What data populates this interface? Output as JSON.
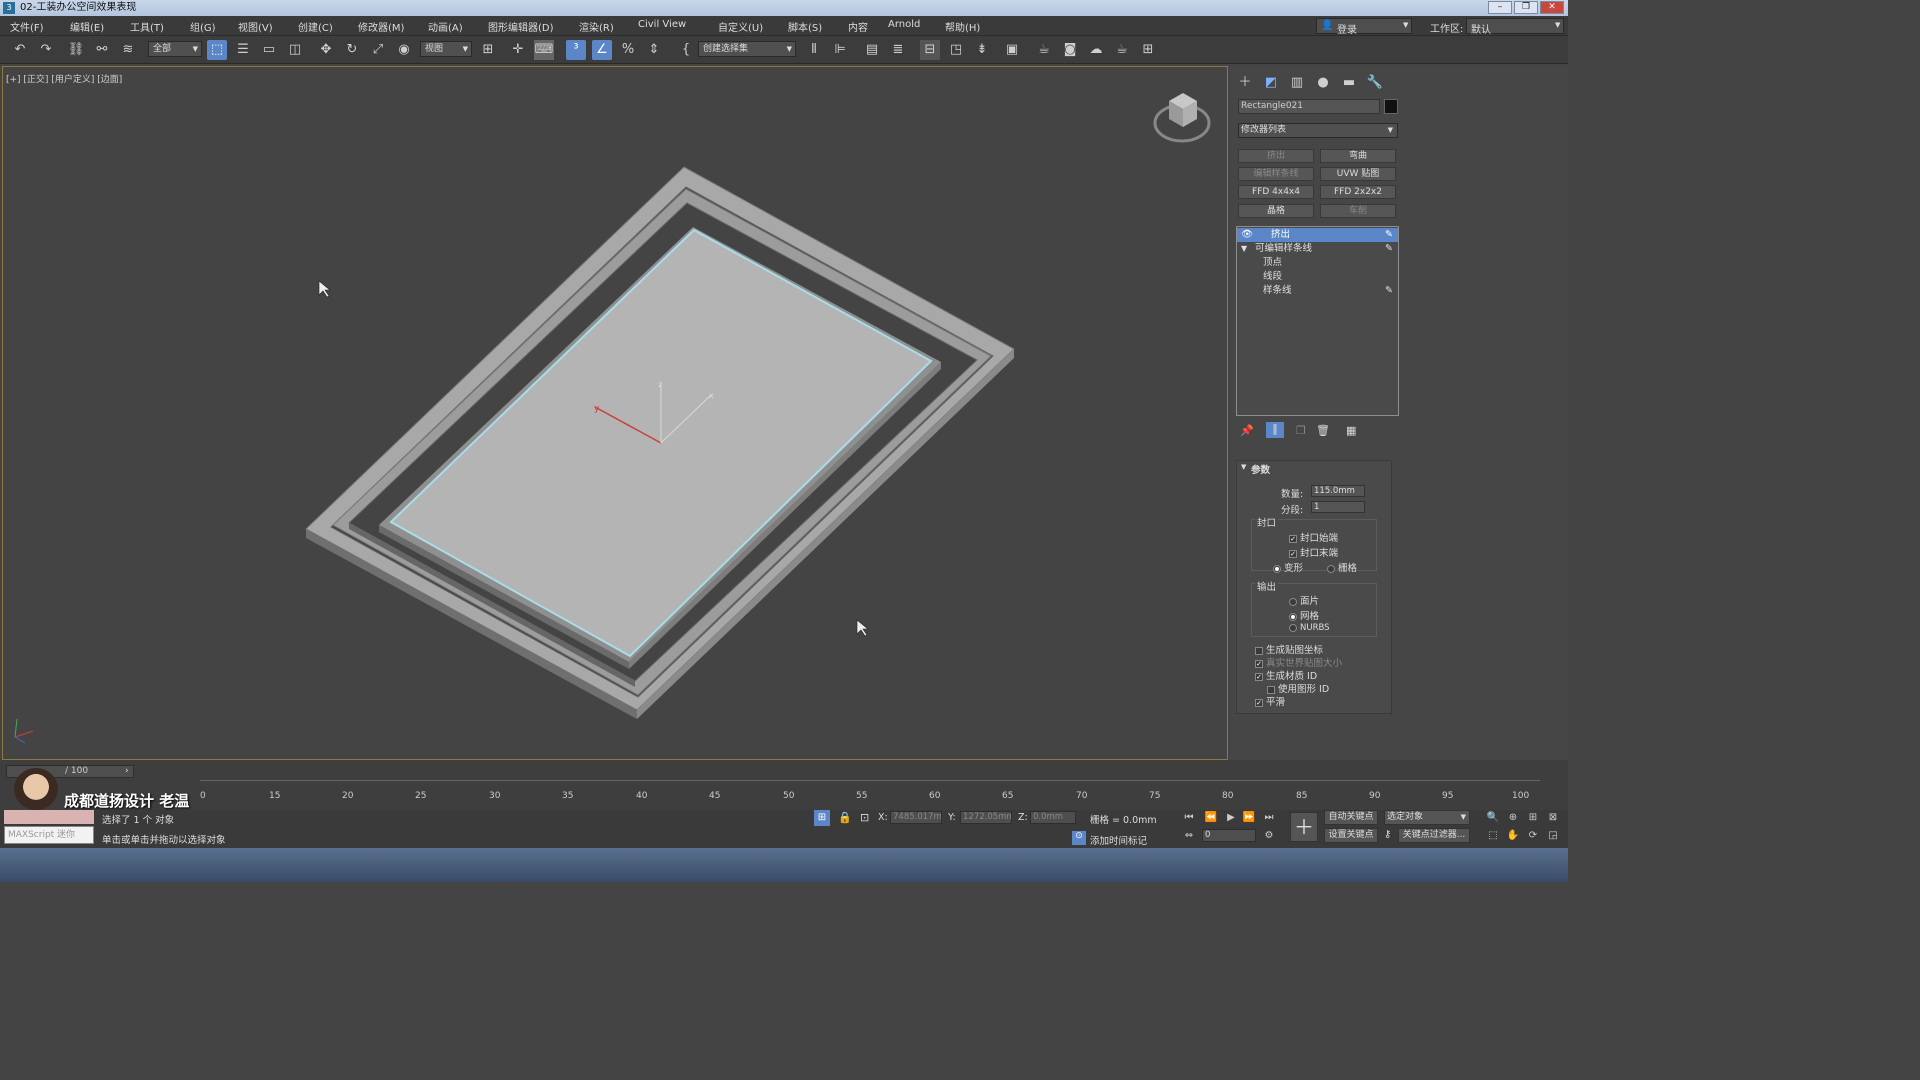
{
  "window": {
    "title": "02-工装办公空间效果表现"
  },
  "menu": [
    "文件(F)",
    "编辑(E)",
    "工具(T)",
    "组(G)",
    "视图(V)",
    "创建(C)",
    "修改器(M)",
    "动画(A)",
    "图形编辑器(D)",
    "渲染(R)",
    "Civil View",
    "自定义(U)",
    "脚本(S)",
    "内容",
    "Arnold",
    "帮助(H)"
  ],
  "account": {
    "login": "登录",
    "workspace_label": "工作区:",
    "workspace_value": "默认"
  },
  "toolbar": {
    "filter": "全部",
    "ref_coord": "视图",
    "selection_set": "创建选择集"
  },
  "viewport": {
    "label": "[+] [正交] [用户定义] [边面]"
  },
  "command_panel": {
    "object_name": "Rectangle021",
    "modifier_list": "修改器列表",
    "modifier_buttons": [
      "挤出",
      "弯曲",
      "编辑样条线",
      "UVW 贴图",
      "FFD 4x4x4",
      "FFD 2x2x2",
      "晶格",
      "车削"
    ],
    "stack": [
      "挤出",
      "可编辑样条线",
      "顶点",
      "线段",
      "样条线"
    ],
    "params_title": "参数",
    "amount_label": "数量:",
    "amount_value": "115.0mm",
    "segments_label": "分段:",
    "segments_value": "1",
    "cap_group": "封口",
    "cap_start": "封口始端",
    "cap_end": "封口末端",
    "morph": "变形",
    "grid": "栅格",
    "output_group": "输出",
    "patch": "面片",
    "mesh": "网格",
    "nurbs": "NURBS",
    "gen_map": "生成贴图坐标",
    "real_world": "真实世界贴图大小",
    "gen_matid": "生成材质 ID",
    "use_shape_id": "使用图形 ID",
    "smooth": "平滑"
  },
  "timeline": {
    "frame_display": "/ 100",
    "ticks": [
      "0",
      "15",
      "20",
      "25",
      "30",
      "35",
      "40",
      "45",
      "50",
      "55",
      "60",
      "65",
      "70",
      "75",
      "80",
      "85",
      "90",
      "95",
      "100"
    ]
  },
  "watermark": "成都道扬设计  老温",
  "status": {
    "maxscript": "MAXScript 迷你",
    "selected": "选择了 1 个 对象",
    "hint": "单击或单击并拖动以选择对象",
    "x_label": "X:",
    "x_value": "7485.017m",
    "y_label": "Y:",
    "y_value": "1272.05mm",
    "z_label": "Z:",
    "z_value": "0.0mm",
    "grid": "栅格 = 0.0mm",
    "add_time_tag": "添加时间标记",
    "auto_key": "自动关键点",
    "set_key": "设置关键点",
    "selected_obj": "选定对象",
    "key_filters": "关键点过滤器...",
    "frame_value": "0"
  }
}
